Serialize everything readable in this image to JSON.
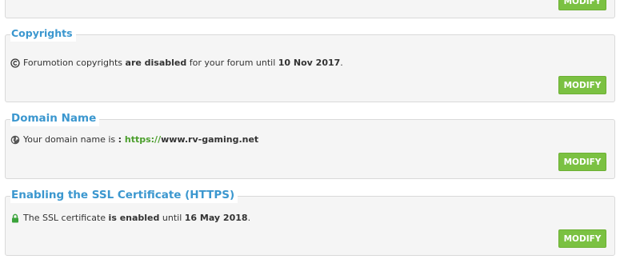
{
  "top_section": {
    "button_label": "MODIFY"
  },
  "copyrights": {
    "title": "Copyrights",
    "text_pre": "Forumotion copyrights ",
    "text_bold": "are disabled",
    "text_mid": " for your forum until ",
    "date": "10 Nov 2017",
    "text_end": ".",
    "button_label": "MODIFY"
  },
  "domain": {
    "title": "Domain Name",
    "text_pre": "Your domain name is ",
    "text_colon": ": ",
    "protocol": "https://",
    "host": "www.rv-gaming.net",
    "button_label": "MODIFY"
  },
  "ssl": {
    "title": "Enabling the SSL Certificate (HTTPS)",
    "text_pre": "The SSL certificate ",
    "text_bold": "is enabled",
    "text_mid": " until ",
    "date": "16 May 2018",
    "text_end": ".",
    "button_label": "MODIFY"
  },
  "colors": {
    "legend": "#3b97cf",
    "button": "#7bc142",
    "link_green": "#4a9e2b"
  },
  "icons": {
    "copyright": "copyright-icon",
    "globe": "globe-icon",
    "lock": "lock-icon"
  }
}
